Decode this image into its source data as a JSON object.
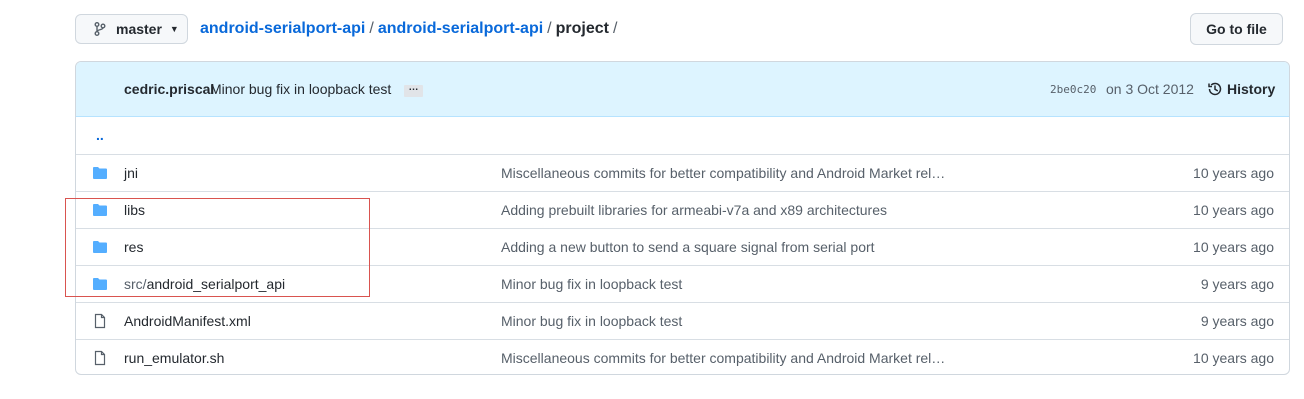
{
  "branch": {
    "label": "master",
    "icon": "git-branch-icon"
  },
  "breadcrumb": {
    "items": [
      "android-serialport-api",
      "android-serialport-api"
    ],
    "current": "project",
    "separator": "/"
  },
  "goto_file": {
    "label": "Go to file"
  },
  "commit": {
    "author": "cedric.priscal",
    "message": "Minor bug fix in loopback test",
    "more": "…",
    "sha": "2be0c20",
    "date": "on 3 Oct 2012",
    "history_label": "History"
  },
  "files": {
    "parent": "..",
    "rows": [
      {
        "type": "folder",
        "prefix": "",
        "name": "jni",
        "message": "Miscellaneous commits for better compatibility and Android Market rel…",
        "age": "10 years ago"
      },
      {
        "type": "folder",
        "prefix": "",
        "name": "libs",
        "message": "Adding prebuilt libraries for armeabi-v7a and x89 architectures",
        "age": "10 years ago"
      },
      {
        "type": "folder",
        "prefix": "",
        "name": "res",
        "message": "Adding a new button to send a square signal from serial port",
        "age": "10 years ago"
      },
      {
        "type": "folder",
        "prefix": "src/",
        "name": "android_serialport_api",
        "message": "Minor bug fix in loopback test",
        "age": "9 years ago"
      },
      {
        "type": "file",
        "prefix": "",
        "name": "AndroidManifest.xml",
        "message": "Minor bug fix in loopback test",
        "age": "9 years ago"
      },
      {
        "type": "file",
        "prefix": "",
        "name": "run_emulator.sh",
        "message": "Miscellaneous commits for better compatibility and Android Market rel…",
        "age": "10 years ago"
      }
    ]
  },
  "colors": {
    "link": "#0969da",
    "folder": "#54aeff",
    "header_bg": "#ddf4ff",
    "annotation_box": "#d9534f"
  }
}
